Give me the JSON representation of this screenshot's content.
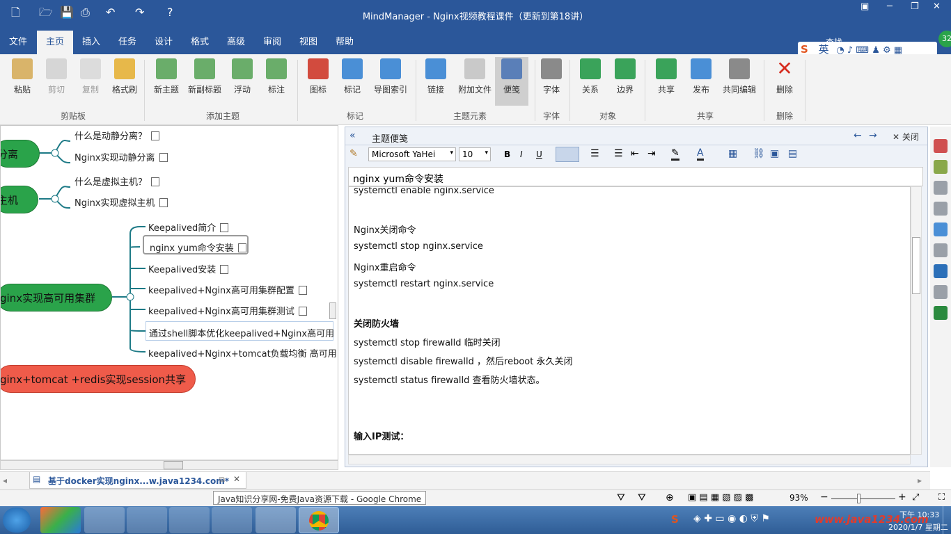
{
  "window": {
    "title": "MindManager - Nginx视频教程课件（更新到第18讲）",
    "search_label": "查找",
    "badge": "32"
  },
  "menu": [
    "文件",
    "主页",
    "插入",
    "任务",
    "设计",
    "格式",
    "高级",
    "审阅",
    "视图",
    "帮助"
  ],
  "ime": {
    "lang": "英"
  },
  "ribbon": {
    "buttons": [
      "粘贴",
      "剪切",
      "复制",
      "格式刷",
      "新主题",
      "新副标题",
      "浮动",
      "标注",
      "图标",
      "标记",
      "导图索引",
      "链接",
      "附加文件",
      "便笺",
      "字体",
      "关系",
      "边界",
      "共享",
      "发布",
      "共同编辑",
      "删除"
    ],
    "groups": [
      "剪贴板",
      "添加主题",
      "标记",
      "主题元素",
      "字体",
      "对象",
      "共享",
      "删除"
    ]
  },
  "map": {
    "branches": [
      {
        "label": "分离",
        "children": [
          "什么是动静分离？",
          "Nginx实现动静分离"
        ]
      },
      {
        "label": "主机",
        "children": [
          "什么是虚拟主机？",
          "Nginx实现虚拟主机"
        ]
      },
      {
        "label": "ginx实现高可用集群",
        "children": [
          "Keepalived简介",
          "nginx yum命令安装",
          "Keepalived安装",
          "keepalived+Nginx高可用集群配置",
          "keepalived+Nginx高可用集群测试",
          "通过shell脚本优化keepalived+Nginx高可用",
          "keepalived+Nginx+tomcat负载均衡 高可用"
        ]
      },
      {
        "label": "ginx+tomcat +redis实现session共享",
        "children": []
      }
    ]
  },
  "notes": {
    "panel_title": "主题便笺",
    "close_label": "关闭",
    "font": "Microsoft YaHei",
    "size": "10",
    "topic": "nginx yum命令安装",
    "lines": [
      "systemctl enable nginx.service",
      "",
      "Nginx关闭命令",
      "systemctl stop nginx.service",
      "Nginx重启命令",
      "systemctl restart nginx.service",
      "",
      "关闭防火墙",
      "systemctl stop firewalld 临时关闭",
      "systemctl disable firewalld ，然后reboot 永久关闭",
      "systemctl status  firewalld 查看防火墙状态。",
      "",
      "",
      "输入IP测试："
    ]
  },
  "doc_tab": "基于docker实现nginx...w.java1234.com*",
  "tooltip": "Java知识分享网-免费Java资源下载 - Google Chrome",
  "status": {
    "zoom": "93%"
  },
  "taskbar": {
    "time": "下午 10:33",
    "date": "2020/1/7 星期二",
    "watermark": "www.java1234.com"
  },
  "colors": {
    "titlebar": "#2b579a",
    "green_node": "#2aa34a",
    "red_node": "#ef5b4a",
    "branch_line": "#1d7a86"
  }
}
